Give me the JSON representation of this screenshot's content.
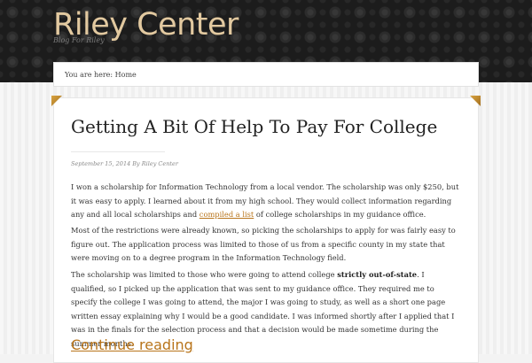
{
  "site": {
    "title": "Riley Center",
    "description": "Blog For Riley"
  },
  "breadcrumb": {
    "text": "You are here: Home"
  },
  "post": {
    "title": "Getting A Bit Of Help To Pay For College",
    "meta": "September 15, 2014 By Riley Center",
    "p1_a": "I won a scholarship for Information Technology from a local vendor. The scholarship was only $250, but it was easy to apply. I learned about it from my high school. They would collect information regarding any and all local scholarships and ",
    "p1_link": "compiled a list",
    "p1_b": " of college scholarships in my guidance office.",
    "p2": "Most of the restrictions were already known, so picking the scholarships to apply for was fairly easy to figure out. The application process was limited to those of us from a specific county in my state that were moving on to a degree program in the Information Technology field.",
    "p3_a": "The scholarship was limited to those who were going to attend college ",
    "p3_strong": "strictly out-of-state",
    "p3_b": ". I qualified, so I picked up the application that was sent to my guidance office. They required me to specify the college I was going to attend, the major I was going to study, as well as a short one page written essay explaining why I would be a good candidate. I was informed shortly after I applied that I was in the finals for the selection process and that a decision would be made sometime during the summer months.",
    "continue": "Continue reading"
  },
  "colors": {
    "accent": "#b8741a",
    "title": "#e2c9a0",
    "header_bg": "#1c1c1c"
  }
}
